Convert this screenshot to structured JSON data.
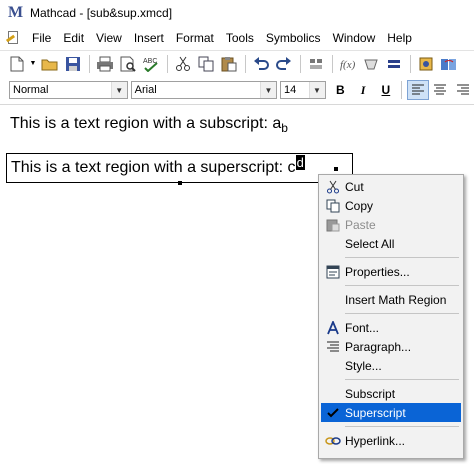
{
  "window": {
    "title": "Mathcad - [sub&sup.xmcd]"
  },
  "menubar": {
    "items": [
      "File",
      "Edit",
      "View",
      "Insert",
      "Format",
      "Tools",
      "Symbolics",
      "Window",
      "Help"
    ]
  },
  "toolbar": {
    "icons": [
      "new-document-icon",
      "open-folder-icon",
      "save-icon",
      "print-icon",
      "print-preview-icon",
      "spell-check-icon",
      "cut-icon",
      "copy-icon",
      "paste-icon",
      "undo-icon",
      "redo-icon",
      "align-icon",
      "insert-function-icon",
      "insert-unit-icon",
      "calculate-icon",
      "component-icon",
      "resources-icon"
    ]
  },
  "formatbar": {
    "style_value": "Normal",
    "font_value": "Arial",
    "size_value": "14",
    "bold_label": "B",
    "italic_label": "I",
    "underline_label": "U"
  },
  "document": {
    "region1_text": "This is a text region with a subscript: a",
    "region1_sub": "b",
    "region2_text": "This is a text region with a superscript: c",
    "region2_selected": "d"
  },
  "context_menu": {
    "items": [
      {
        "label": "Cut",
        "icon": "scissors-icon",
        "disabled": false,
        "checked": false
      },
      {
        "label": "Copy",
        "icon": "copy-icon",
        "disabled": false,
        "checked": false
      },
      {
        "label": "Paste",
        "icon": "clipboard-icon",
        "disabled": true,
        "checked": false
      },
      {
        "label": "Select All",
        "icon": "",
        "disabled": false,
        "checked": false
      },
      {
        "label": "Properties...",
        "icon": "properties-icon",
        "disabled": false,
        "checked": false
      },
      {
        "label": "Insert Math Region",
        "icon": "",
        "disabled": false,
        "checked": false
      },
      {
        "label": "Font...",
        "icon": "font-icon",
        "disabled": false,
        "checked": false
      },
      {
        "label": "Paragraph...",
        "icon": "paragraph-icon",
        "disabled": false,
        "checked": false
      },
      {
        "label": "Style...",
        "icon": "",
        "disabled": false,
        "checked": false
      },
      {
        "label": "Subscript",
        "icon": "",
        "disabled": false,
        "checked": false
      },
      {
        "label": "Superscript",
        "icon": "check-icon",
        "disabled": false,
        "checked": true,
        "highlighted": true
      },
      {
        "label": "Hyperlink...",
        "icon": "hyperlink-icon",
        "disabled": false,
        "checked": false
      }
    ]
  },
  "colors": {
    "menu_highlight": "#0a64d6",
    "app_icon": "#3a4f8f"
  }
}
